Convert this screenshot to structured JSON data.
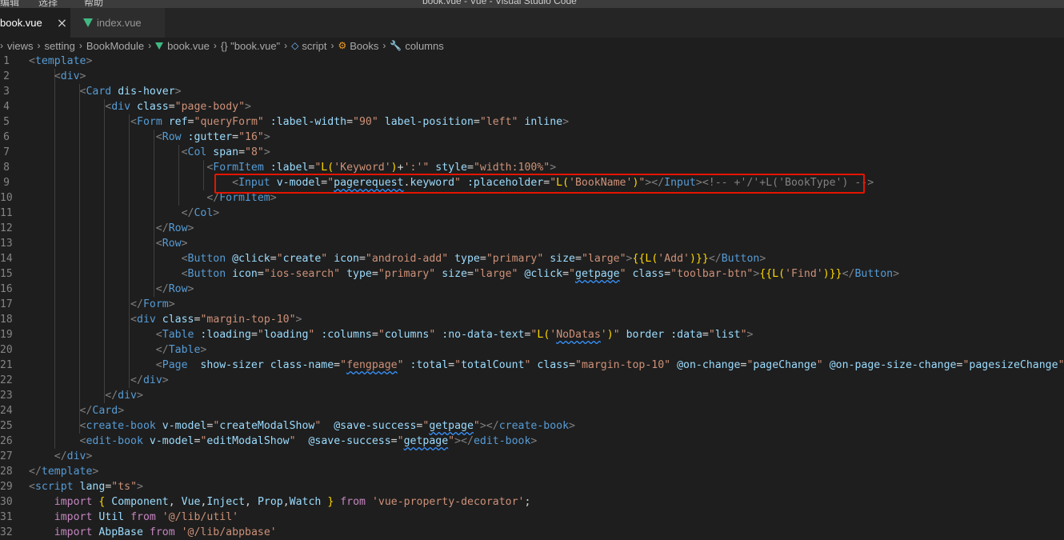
{
  "window": {
    "title": "book.vue - Vue - Visual Studio Code",
    "menu": [
      "编辑",
      "选择",
      "帮助"
    ]
  },
  "tabs": [
    {
      "label": "book.vue",
      "active": true
    },
    {
      "label": "index.vue",
      "active": false
    }
  ],
  "breadcrumb": [
    "views",
    "setting",
    "BookModule",
    "book.vue",
    "{} \"book.vue\"",
    "script",
    "Books",
    "columns"
  ],
  "colors": {
    "accent_highlight": "#e51400",
    "vue_icon": "#41b883",
    "tag": "#569cd6",
    "attr": "#9cdcfe",
    "string": "#ce9178"
  },
  "code": [
    [
      [
        "p",
        "<"
      ],
      [
        "t",
        "template"
      ],
      [
        "p",
        ">"
      ]
    ],
    [
      [
        "d",
        "    "
      ],
      [
        "p",
        "<"
      ],
      [
        "t",
        "div"
      ],
      [
        "p",
        ">"
      ]
    ],
    [
      [
        "d",
        "        "
      ],
      [
        "p",
        "<"
      ],
      [
        "t",
        "Card"
      ],
      [
        "d",
        " "
      ],
      [
        "a",
        "dis-hover"
      ],
      [
        "p",
        ">"
      ]
    ],
    [
      [
        "d",
        "            "
      ],
      [
        "p",
        "<"
      ],
      [
        "t",
        "div"
      ],
      [
        "d",
        " "
      ],
      [
        "a",
        "class"
      ],
      [
        "d",
        "="
      ],
      [
        "s",
        "\"page-body\""
      ],
      [
        "p",
        ">"
      ]
    ],
    [
      [
        "d",
        "                "
      ],
      [
        "p",
        "<"
      ],
      [
        "t",
        "Form"
      ],
      [
        "d",
        " "
      ],
      [
        "a",
        "ref"
      ],
      [
        "d",
        "="
      ],
      [
        "s",
        "\"queryForm\""
      ],
      [
        "d",
        " "
      ],
      [
        "a",
        ":label-width"
      ],
      [
        "d",
        "="
      ],
      [
        "s",
        "\"90\""
      ],
      [
        "d",
        " "
      ],
      [
        "a",
        "label-position"
      ],
      [
        "d",
        "="
      ],
      [
        "s",
        "\"left\""
      ],
      [
        "d",
        " "
      ],
      [
        "a",
        "inline"
      ],
      [
        "p",
        ">"
      ]
    ],
    [
      [
        "d",
        "                    "
      ],
      [
        "p",
        "<"
      ],
      [
        "t",
        "Row"
      ],
      [
        "d",
        " "
      ],
      [
        "a",
        ":gutter"
      ],
      [
        "d",
        "="
      ],
      [
        "s",
        "\"16\""
      ],
      [
        "p",
        ">"
      ]
    ],
    [
      [
        "d",
        "                        "
      ],
      [
        "p",
        "<"
      ],
      [
        "t",
        "Col"
      ],
      [
        "d",
        " "
      ],
      [
        "a",
        "span"
      ],
      [
        "d",
        "="
      ],
      [
        "s",
        "\"8\""
      ],
      [
        "p",
        ">"
      ]
    ],
    [
      [
        "d",
        "                            "
      ],
      [
        "p",
        "<"
      ],
      [
        "t",
        "FormItem"
      ],
      [
        "d",
        " "
      ],
      [
        "a",
        ":label"
      ],
      [
        "d",
        "="
      ],
      [
        "s",
        "\""
      ],
      [
        "y",
        "L("
      ],
      [
        "s",
        "'Keyword'"
      ],
      [
        "y",
        ")"
      ],
      [
        "d",
        "+"
      ],
      [
        "s",
        "':'"
      ],
      [
        "s",
        "\""
      ],
      [
        "d",
        " "
      ],
      [
        "a",
        "style"
      ],
      [
        "d",
        "="
      ],
      [
        "s",
        "\"width:100%\""
      ],
      [
        "p",
        ">"
      ]
    ],
    [
      [
        "d",
        "                                "
      ],
      [
        "p",
        "<"
      ],
      [
        "t",
        "Input"
      ],
      [
        "d",
        " "
      ],
      [
        "a",
        "v-model"
      ],
      [
        "d",
        "="
      ],
      [
        "s",
        "\""
      ],
      [
        "v",
        "pagerequest",
        1
      ],
      [
        "d",
        "."
      ],
      [
        "v",
        "keyword"
      ],
      [
        "s",
        "\""
      ],
      [
        "d",
        " "
      ],
      [
        "a",
        ":placeholder"
      ],
      [
        "d",
        "="
      ],
      [
        "s",
        "\""
      ],
      [
        "y",
        "L("
      ],
      [
        "s",
        "'BookName'"
      ],
      [
        "y",
        ")"
      ],
      [
        "s",
        "\""
      ],
      [
        "p",
        "></"
      ],
      [
        "t",
        "Input"
      ],
      [
        "p",
        ">"
      ],
      [
        "p",
        "<!-- +'/'+L('BookType') -->"
      ]
    ],
    [
      [
        "d",
        "                            "
      ],
      [
        "p",
        "</"
      ],
      [
        "t",
        "FormItem"
      ],
      [
        "p",
        ">"
      ]
    ],
    [
      [
        "d",
        "                        "
      ],
      [
        "p",
        "</"
      ],
      [
        "t",
        "Col"
      ],
      [
        "p",
        ">"
      ]
    ],
    [
      [
        "d",
        "                    "
      ],
      [
        "p",
        "</"
      ],
      [
        "t",
        "Row"
      ],
      [
        "p",
        ">"
      ]
    ],
    [
      [
        "d",
        "                    "
      ],
      [
        "p",
        "<"
      ],
      [
        "t",
        "Row"
      ],
      [
        "p",
        ">"
      ]
    ],
    [
      [
        "d",
        "                        "
      ],
      [
        "p",
        "<"
      ],
      [
        "t",
        "Button"
      ],
      [
        "d",
        " "
      ],
      [
        "a",
        "@click"
      ],
      [
        "d",
        "="
      ],
      [
        "s",
        "\""
      ],
      [
        "v",
        "create"
      ],
      [
        "s",
        "\""
      ],
      [
        "d",
        " "
      ],
      [
        "a",
        "icon"
      ],
      [
        "d",
        "="
      ],
      [
        "s",
        "\"android-add\""
      ],
      [
        "d",
        " "
      ],
      [
        "a",
        "type"
      ],
      [
        "d",
        "="
      ],
      [
        "s",
        "\"primary\""
      ],
      [
        "d",
        " "
      ],
      [
        "a",
        "size"
      ],
      [
        "d",
        "="
      ],
      [
        "s",
        "\"large\""
      ],
      [
        "p",
        ">"
      ],
      [
        "y",
        "{{"
      ],
      [
        "y",
        "L("
      ],
      [
        "s",
        "'Add'"
      ],
      [
        "y",
        ")"
      ],
      [
        "y",
        "}}"
      ],
      [
        "p",
        "</"
      ],
      [
        "t",
        "Button"
      ],
      [
        "p",
        ">"
      ]
    ],
    [
      [
        "d",
        "                        "
      ],
      [
        "p",
        "<"
      ],
      [
        "t",
        "Button"
      ],
      [
        "d",
        " "
      ],
      [
        "a",
        "icon"
      ],
      [
        "d",
        "="
      ],
      [
        "s",
        "\"ios-search\""
      ],
      [
        "d",
        " "
      ],
      [
        "a",
        "type"
      ],
      [
        "d",
        "="
      ],
      [
        "s",
        "\"primary\""
      ],
      [
        "d",
        " "
      ],
      [
        "a",
        "size"
      ],
      [
        "d",
        "="
      ],
      [
        "s",
        "\"large\""
      ],
      [
        "d",
        " "
      ],
      [
        "a",
        "@click"
      ],
      [
        "d",
        "="
      ],
      [
        "s",
        "\""
      ],
      [
        "v",
        "getpage",
        1
      ],
      [
        "s",
        "\""
      ],
      [
        "d",
        " "
      ],
      [
        "a",
        "class"
      ],
      [
        "d",
        "="
      ],
      [
        "s",
        "\"toolbar-btn\""
      ],
      [
        "p",
        ">"
      ],
      [
        "y",
        "{{"
      ],
      [
        "y",
        "L("
      ],
      [
        "s",
        "'Find'"
      ],
      [
        "y",
        ")"
      ],
      [
        "y",
        "}}"
      ],
      [
        "p",
        "</"
      ],
      [
        "t",
        "Button"
      ],
      [
        "p",
        ">"
      ]
    ],
    [
      [
        "d",
        "                    "
      ],
      [
        "p",
        "</"
      ],
      [
        "t",
        "Row"
      ],
      [
        "p",
        ">"
      ]
    ],
    [
      [
        "d",
        "                "
      ],
      [
        "p",
        "</"
      ],
      [
        "t",
        "Form"
      ],
      [
        "p",
        ">"
      ]
    ],
    [
      [
        "d",
        "                "
      ],
      [
        "p",
        "<"
      ],
      [
        "t",
        "div"
      ],
      [
        "d",
        " "
      ],
      [
        "a",
        "class"
      ],
      [
        "d",
        "="
      ],
      [
        "s",
        "\"margin-top-10\""
      ],
      [
        "p",
        ">"
      ]
    ],
    [
      [
        "d",
        "                    "
      ],
      [
        "p",
        "<"
      ],
      [
        "t",
        "Table"
      ],
      [
        "d",
        " "
      ],
      [
        "a",
        ":loading"
      ],
      [
        "d",
        "="
      ],
      [
        "s",
        "\""
      ],
      [
        "v",
        "loading"
      ],
      [
        "s",
        "\""
      ],
      [
        "d",
        " "
      ],
      [
        "a",
        ":columns"
      ],
      [
        "d",
        "="
      ],
      [
        "s",
        "\""
      ],
      [
        "v",
        "columns"
      ],
      [
        "s",
        "\""
      ],
      [
        "d",
        " "
      ],
      [
        "a",
        ":no-data-text"
      ],
      [
        "d",
        "="
      ],
      [
        "s",
        "\""
      ],
      [
        "y",
        "L("
      ],
      [
        "s",
        "'"
      ],
      [
        "s",
        "NoDatas",
        1
      ],
      [
        "s",
        "'"
      ],
      [
        "y",
        ")"
      ],
      [
        "s",
        "\""
      ],
      [
        "d",
        " "
      ],
      [
        "a",
        "border"
      ],
      [
        "d",
        " "
      ],
      [
        "a",
        ":data"
      ],
      [
        "d",
        "="
      ],
      [
        "s",
        "\""
      ],
      [
        "v",
        "list"
      ],
      [
        "s",
        "\""
      ],
      [
        "p",
        ">"
      ]
    ],
    [
      [
        "d",
        "                    "
      ],
      [
        "p",
        "</"
      ],
      [
        "t",
        "Table"
      ],
      [
        "p",
        ">"
      ]
    ],
    [
      [
        "d",
        "                    "
      ],
      [
        "p",
        "<"
      ],
      [
        "t",
        "Page"
      ],
      [
        "d",
        "  "
      ],
      [
        "a",
        "show-sizer"
      ],
      [
        "d",
        " "
      ],
      [
        "a",
        "class-name"
      ],
      [
        "d",
        "="
      ],
      [
        "s",
        "\""
      ],
      [
        "s",
        "fengpage",
        1
      ],
      [
        "s",
        "\""
      ],
      [
        "d",
        " "
      ],
      [
        "a",
        ":total"
      ],
      [
        "d",
        "="
      ],
      [
        "s",
        "\""
      ],
      [
        "v",
        "totalCount"
      ],
      [
        "s",
        "\""
      ],
      [
        "d",
        " "
      ],
      [
        "a",
        "class"
      ],
      [
        "d",
        "="
      ],
      [
        "s",
        "\"margin-top-10\""
      ],
      [
        "d",
        " "
      ],
      [
        "a",
        "@on-change"
      ],
      [
        "d",
        "="
      ],
      [
        "s",
        "\""
      ],
      [
        "v",
        "pageChange"
      ],
      [
        "s",
        "\""
      ],
      [
        "d",
        " "
      ],
      [
        "a",
        "@on-page-size-change"
      ],
      [
        "d",
        "="
      ],
      [
        "s",
        "\""
      ],
      [
        "v",
        "pagesizeChange"
      ],
      [
        "s",
        "\""
      ],
      [
        "d",
        " "
      ],
      [
        "a",
        ":pag"
      ]
    ],
    [
      [
        "d",
        "                "
      ],
      [
        "p",
        "</"
      ],
      [
        "t",
        "div"
      ],
      [
        "p",
        ">"
      ]
    ],
    [
      [
        "d",
        "            "
      ],
      [
        "p",
        "</"
      ],
      [
        "t",
        "div"
      ],
      [
        "p",
        ">"
      ]
    ],
    [
      [
        "d",
        "        "
      ],
      [
        "p",
        "</"
      ],
      [
        "t",
        "Card"
      ],
      [
        "p",
        ">"
      ]
    ],
    [
      [
        "d",
        "        "
      ],
      [
        "p",
        "<"
      ],
      [
        "t",
        "create-book"
      ],
      [
        "d",
        " "
      ],
      [
        "a",
        "v-model"
      ],
      [
        "d",
        "="
      ],
      [
        "s",
        "\""
      ],
      [
        "v",
        "createModalShow"
      ],
      [
        "s",
        "\""
      ],
      [
        "d",
        "  "
      ],
      [
        "a",
        "@save-success"
      ],
      [
        "d",
        "="
      ],
      [
        "s",
        "\""
      ],
      [
        "v",
        "getpage",
        1
      ],
      [
        "s",
        "\""
      ],
      [
        "p",
        "></"
      ],
      [
        "t",
        "create-book"
      ],
      [
        "p",
        ">"
      ]
    ],
    [
      [
        "d",
        "        "
      ],
      [
        "p",
        "<"
      ],
      [
        "t",
        "edit-book"
      ],
      [
        "d",
        " "
      ],
      [
        "a",
        "v-model"
      ],
      [
        "d",
        "="
      ],
      [
        "s",
        "\""
      ],
      [
        "v",
        "editModalShow"
      ],
      [
        "s",
        "\""
      ],
      [
        "d",
        "  "
      ],
      [
        "a",
        "@save-success"
      ],
      [
        "d",
        "="
      ],
      [
        "s",
        "\""
      ],
      [
        "v",
        "getpage",
        1
      ],
      [
        "s",
        "\""
      ],
      [
        "p",
        "></"
      ],
      [
        "t",
        "edit-book"
      ],
      [
        "p",
        ">"
      ]
    ],
    [
      [
        "d",
        "    "
      ],
      [
        "p",
        "</"
      ],
      [
        "t",
        "div"
      ],
      [
        "p",
        ">"
      ]
    ],
    [
      [
        "p",
        "</"
      ],
      [
        "t",
        "template"
      ],
      [
        "p",
        ">"
      ]
    ],
    [
      [
        "p",
        "<"
      ],
      [
        "t",
        "script"
      ],
      [
        "d",
        " "
      ],
      [
        "a",
        "lang"
      ],
      [
        "d",
        "="
      ],
      [
        "s",
        "\"ts\""
      ],
      [
        "p",
        ">"
      ]
    ],
    [
      [
        "d",
        "    "
      ],
      [
        "k",
        "import"
      ],
      [
        "d",
        " "
      ],
      [
        "y",
        "{"
      ],
      [
        "d",
        " "
      ],
      [
        "v",
        "Component"
      ],
      [
        "d",
        ", "
      ],
      [
        "v",
        "Vue"
      ],
      [
        "d",
        ","
      ],
      [
        "v",
        "Inject"
      ],
      [
        "d",
        ", "
      ],
      [
        "v",
        "Prop"
      ],
      [
        "d",
        ","
      ],
      [
        "v",
        "Watch"
      ],
      [
        "d",
        " "
      ],
      [
        "y",
        "}"
      ],
      [
        "d",
        " "
      ],
      [
        "k",
        "from"
      ],
      [
        "d",
        " "
      ],
      [
        "s",
        "'vue-property-decorator'"
      ],
      [
        "d",
        ";"
      ]
    ],
    [
      [
        "d",
        "    "
      ],
      [
        "k",
        "import"
      ],
      [
        "d",
        " "
      ],
      [
        "v",
        "Util"
      ],
      [
        "d",
        " "
      ],
      [
        "k",
        "from"
      ],
      [
        "d",
        " "
      ],
      [
        "s",
        "'@/lib/util'"
      ]
    ],
    [
      [
        "d",
        "    "
      ],
      [
        "k",
        "import"
      ],
      [
        "d",
        " "
      ],
      [
        "v",
        "AbpBase"
      ],
      [
        "d",
        " "
      ],
      [
        "k",
        "from"
      ],
      [
        "d",
        " "
      ],
      [
        "s",
        "'@/lib/abpbase'"
      ]
    ]
  ]
}
